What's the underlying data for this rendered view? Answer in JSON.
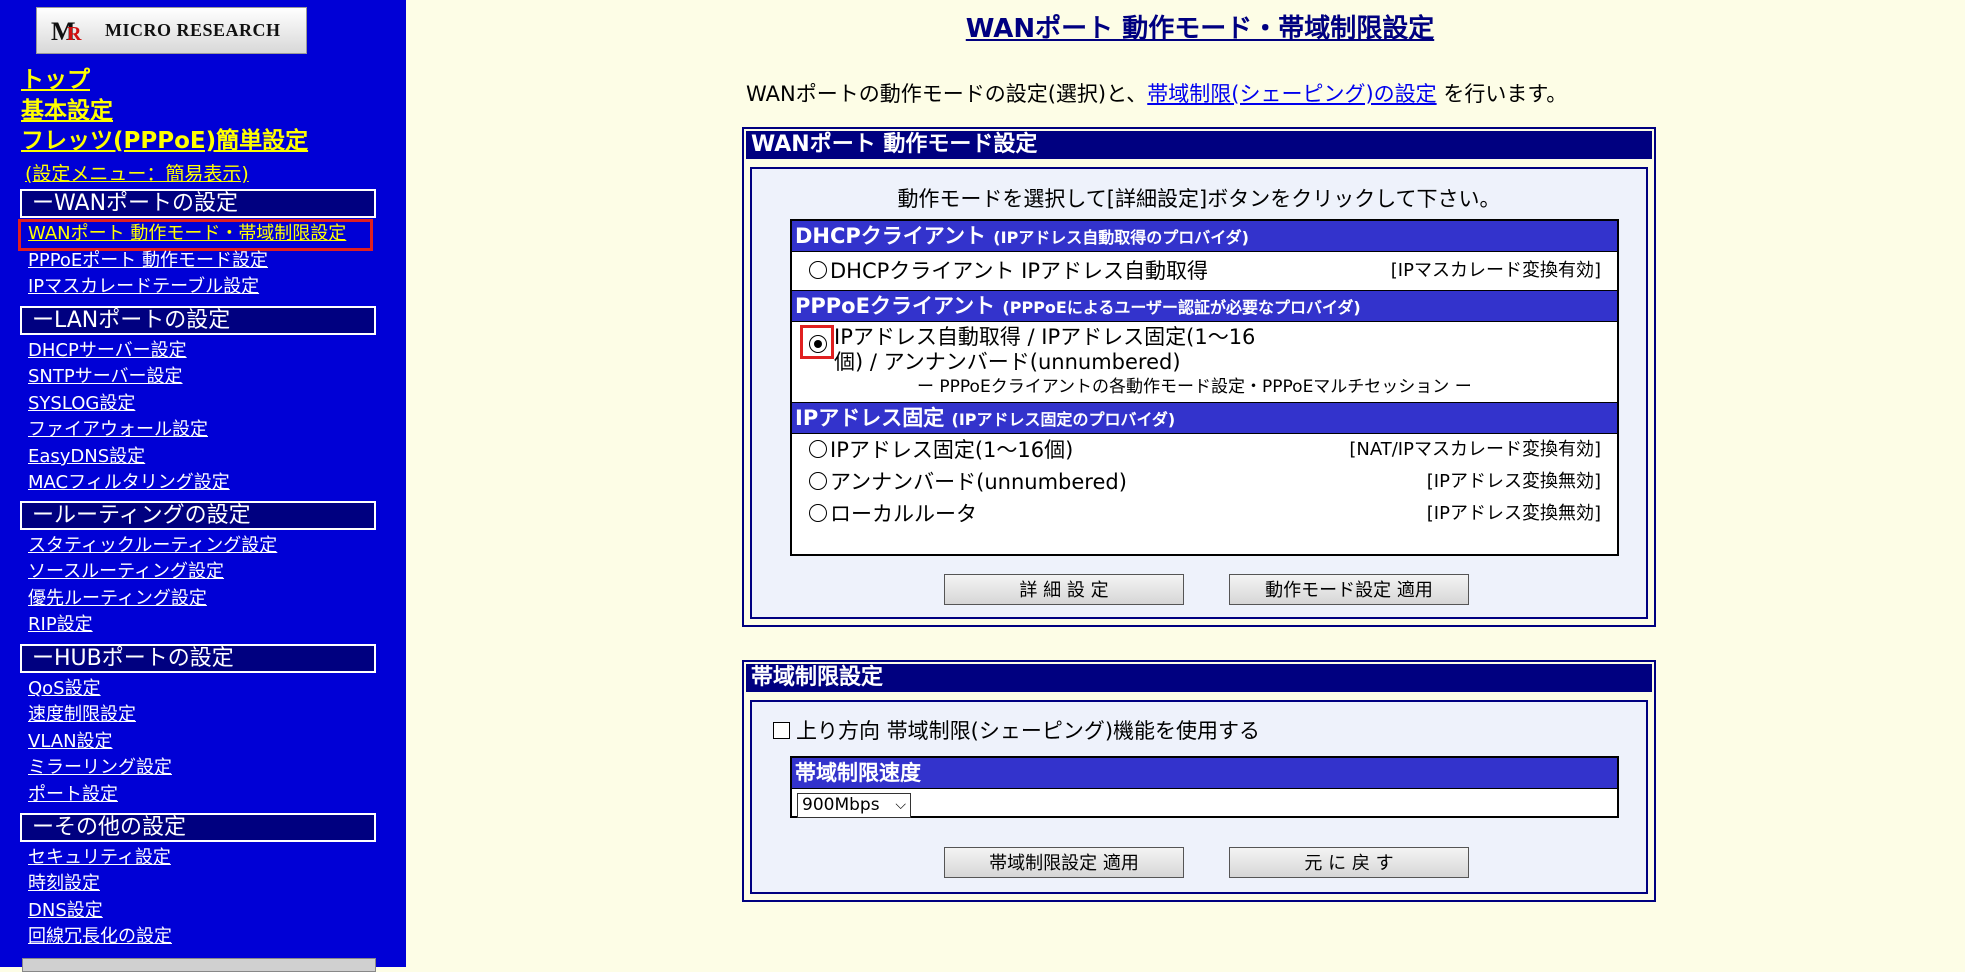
{
  "sidebar": {
    "logo_text": "MICRO RESEARCH",
    "top_links": [
      "トップ",
      "基本設定",
      "フレッツ(PPPoE)簡単設定"
    ],
    "menu_note": "(設定メニュー：簡易表示)",
    "sections": [
      {
        "header": "ーWANポートの設定",
        "items": [
          "WANポート 動作モード・帯域制限設定",
          "PPPoEポート 動作モード設定",
          "IPマスカレードテーブル設定"
        ]
      },
      {
        "header": "ーLANポートの設定",
        "items": [
          "DHCPサーバー設定",
          "SNTPサーバー設定",
          "SYSLOG設定",
          "ファイアウォール設定",
          "EasyDNS設定",
          "MACフィルタリング設定"
        ]
      },
      {
        "header": "ールーティングの設定",
        "items": [
          "スタティックルーティング設定",
          "ソースルーティング設定",
          "優先ルーティング設定",
          "RIP設定"
        ]
      },
      {
        "header": "ーHUBポートの設定",
        "items": [
          "QoS設定",
          "速度制限設定",
          "VLAN設定",
          "ミラーリング設定",
          "ポート設定"
        ]
      },
      {
        "header": "ーその他の設定",
        "items": [
          "セキュリティ設定",
          "時刻設定",
          "DNS設定",
          "回線冗長化の設定"
        ]
      }
    ],
    "active_item": "WANポート 動作モード・帯域制限設定"
  },
  "main": {
    "page_title": "WANポート 動作モード・帯域制限設定",
    "intro_prefix": "WANポートの動作モードの設定(選択)と、",
    "intro_link": "帯域制限(シェーピング)の設定",
    "intro_suffix": " を行います。",
    "mode_panel": {
      "title": "WANポート 動作モード設定",
      "instruction": "動作モードを選択して[詳細設定]ボタンをクリックして下さい。",
      "dhcp": {
        "label": "DHCPクライアント",
        "sub": "(IPアドレス自動取得のプロバイダ)",
        "option": "DHCPクライアント IPアドレス自動取得",
        "note": "[IPマスカレード変換有効]"
      },
      "pppoe": {
        "label": "PPPoEクライアント",
        "sub": "(PPPoEによるユーザー認証が必要なプロバイダ)",
        "option_line1": "IPアドレス自動取得 / IPアドレス固定(1〜16",
        "option_line2": "個) / アンナンバード(unnumbered)",
        "option_line3": "ー PPPoEクライアントの各動作モード設定・PPPoEマルチセッション ー"
      },
      "fixed": {
        "label": "IPアドレス固定",
        "sub": "(IPアドレス固定のプロバイダ)",
        "options": [
          {
            "label": "IPアドレス固定(1〜16個)",
            "note": "[NAT/IPマスカレード変換有効]"
          },
          {
            "label": "アンナンバード(unnumbered)",
            "note": "[IPアドレス変換無効]"
          },
          {
            "label": "ローカルルータ",
            "note": "[IPアドレス変換無効]"
          }
        ]
      },
      "selected_mode": "PPPoEクライアント",
      "detail_button": "詳 細 設 定",
      "apply_button": "動作モード設定 適用"
    },
    "bandwidth_panel": {
      "title": "帯域制限設定",
      "checkbox_label": "上り方向 帯域制限(シェーピング)機能を使用する",
      "checkbox_checked": false,
      "speed_label": "帯域制限速度",
      "speed_value": "900Mbps",
      "apply_button": "帯域制限設定 適用",
      "reset_button": "元 に 戻 す"
    }
  }
}
